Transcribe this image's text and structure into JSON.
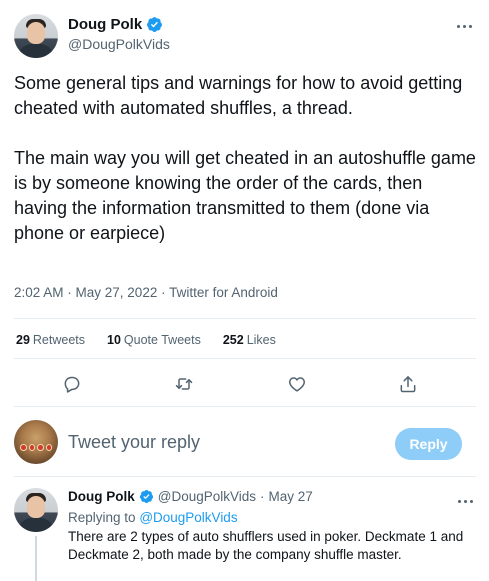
{
  "author": {
    "display_name": "Doug Polk",
    "handle": "@DougPolkVids"
  },
  "tweet": {
    "paragraphs": [
      "Some general tips and warnings for how to avoid getting cheated with automated shuffles, a thread.",
      "The main way you will get cheated in an autoshuffle game is by someone knowing the order of the cards, then having the information transmitted to them (done via phone or earpiece)"
    ],
    "meta": "2:02 AM · May 27, 2022 · Twitter for Android"
  },
  "stats": {
    "retweets_count": "29",
    "retweets_label": "Retweets",
    "quote_count": "10",
    "quote_label": "Quote Tweets",
    "likes_count": "252",
    "likes_label": "Likes"
  },
  "actions": [
    {
      "name": "reply-icon"
    },
    {
      "name": "retweet-icon"
    },
    {
      "name": "like-icon"
    },
    {
      "name": "share-icon"
    }
  ],
  "composer": {
    "placeholder": "Tweet your reply",
    "button_label": "Reply"
  },
  "reply": {
    "display_name": "Doug Polk",
    "handle": "@DougPolkVids",
    "separator": "·",
    "date": "May 27",
    "replying_prefix": "Replying to",
    "replying_mention": "@DougPolkVids",
    "text": "There are 2 types of auto shufflers used in poker. Deckmate 1 and Deckmate 2, both made by the company shuffle master."
  },
  "colors": {
    "accent": "#1d9bf0",
    "reply_button_disabled": "#8ecdf8",
    "secondary_text": "#536471",
    "divider": "#e6ecf0"
  }
}
